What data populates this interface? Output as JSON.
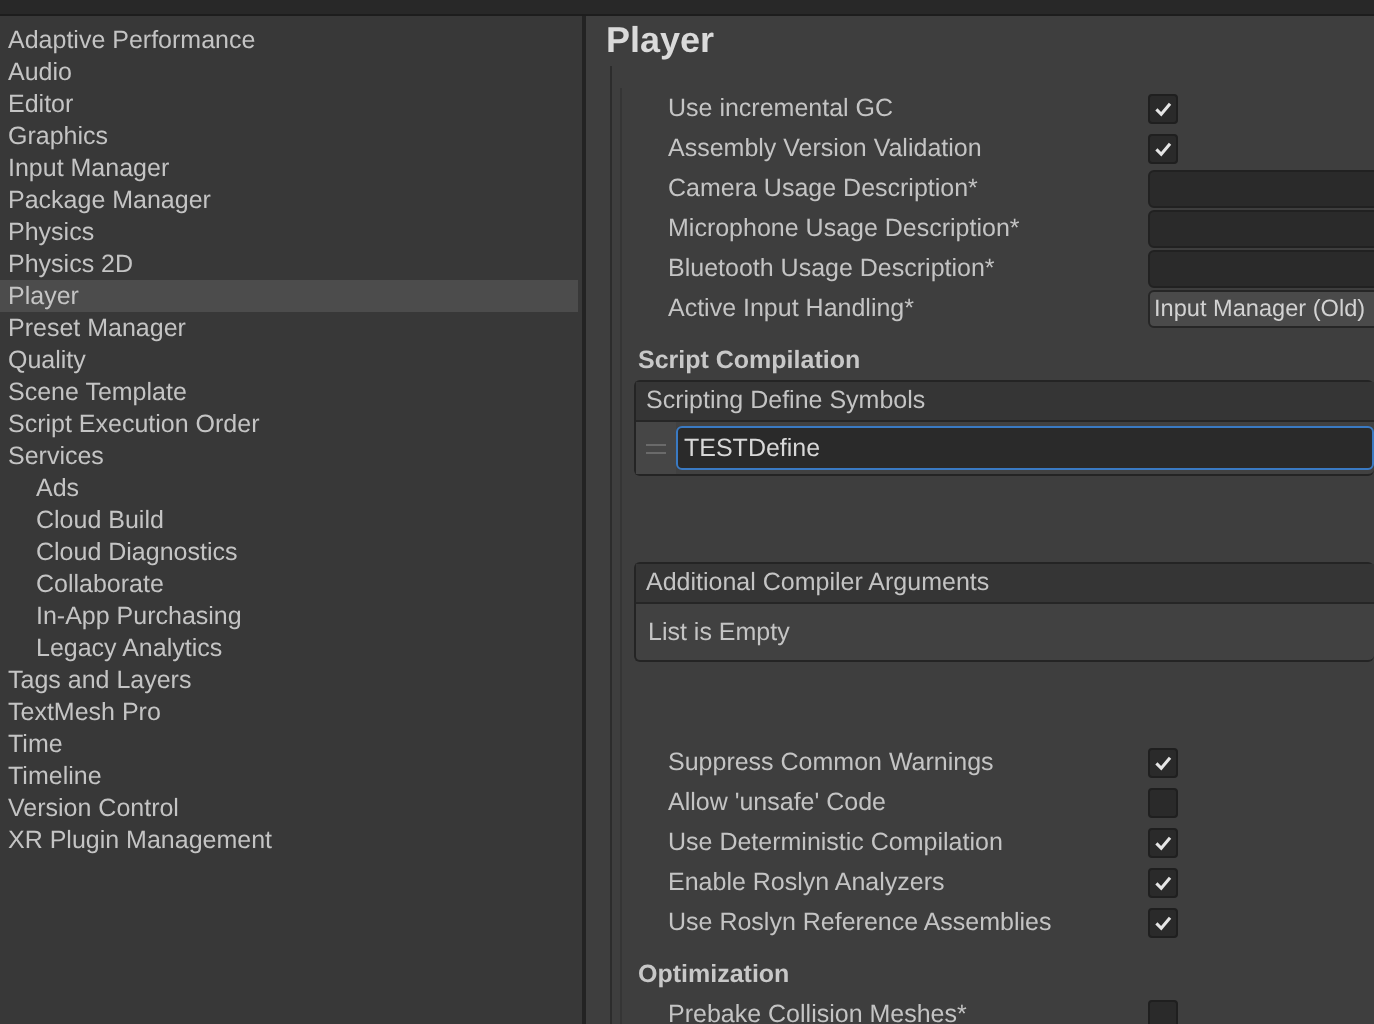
{
  "sidebar": {
    "items": [
      {
        "label": "Adaptive Performance",
        "selected": false
      },
      {
        "label": "Audio",
        "selected": false
      },
      {
        "label": "Editor",
        "selected": false
      },
      {
        "label": "Graphics",
        "selected": false
      },
      {
        "label": "Input Manager",
        "selected": false
      },
      {
        "label": "Package Manager",
        "selected": false
      },
      {
        "label": "Physics",
        "selected": false
      },
      {
        "label": "Physics 2D",
        "selected": false
      },
      {
        "label": "Player",
        "selected": true
      },
      {
        "label": "Preset Manager",
        "selected": false
      },
      {
        "label": "Quality",
        "selected": false
      },
      {
        "label": "Scene Template",
        "selected": false
      },
      {
        "label": "Script Execution Order",
        "selected": false
      },
      {
        "label": "Services",
        "selected": false,
        "children": [
          {
            "label": "Ads",
            "selected": false
          },
          {
            "label": "Cloud Build",
            "selected": false
          },
          {
            "label": "Cloud Diagnostics",
            "selected": false
          },
          {
            "label": "Collaborate",
            "selected": false
          },
          {
            "label": "In-App Purchasing",
            "selected": false
          },
          {
            "label": "Legacy Analytics",
            "selected": false
          }
        ]
      },
      {
        "label": "Tags and Layers",
        "selected": false
      },
      {
        "label": "TextMesh Pro",
        "selected": false
      },
      {
        "label": "Time",
        "selected": false
      },
      {
        "label": "Timeline",
        "selected": false
      },
      {
        "label": "Version Control",
        "selected": false
      },
      {
        "label": "XR Plugin Management",
        "selected": false
      }
    ]
  },
  "panel": {
    "title": "Player",
    "sections": [
      {
        "kind": "rows",
        "rows": [
          {
            "kind": "checkbox",
            "label": "Use incremental GC",
            "checked": true
          },
          {
            "kind": "checkbox",
            "label": "Assembly Version Validation",
            "checked": true
          },
          {
            "kind": "text_field",
            "label": "Camera Usage Description*"
          },
          {
            "kind": "text_field",
            "label": "Microphone Usage Description*"
          },
          {
            "kind": "text_field",
            "label": "Bluetooth Usage Description*"
          },
          {
            "kind": "dropdown",
            "label": "Active Input Handling*",
            "value": "Input Manager (Old)",
            "disabled": false
          }
        ]
      },
      {
        "kind": "heading",
        "title": "Script Compilation"
      },
      {
        "kind": "list",
        "title": "Scripting Define Symbols",
        "items": [
          {
            "value": "TESTDefine",
            "focused": true
          }
        ]
      },
      {
        "kind": "list",
        "title": "Additional Compiler Arguments",
        "empty_text": "List is Empty"
      },
      {
        "kind": "rows",
        "rows": [
          {
            "kind": "checkbox",
            "label": "Suppress Common Warnings",
            "checked": true
          },
          {
            "kind": "checkbox",
            "label": "Allow 'unsafe' Code",
            "checked": false
          },
          {
            "kind": "checkbox",
            "label": "Use Deterministic Compilation",
            "checked": true
          },
          {
            "kind": "checkbox",
            "label": "Enable Roslyn Analyzers",
            "checked": true
          },
          {
            "kind": "checkbox",
            "label": "Use Roslyn Reference Assemblies",
            "checked": true
          }
        ]
      },
      {
        "kind": "heading",
        "title": "Optimization"
      },
      {
        "kind": "rows",
        "rows": [
          {
            "kind": "checkbox",
            "label": "Prebake Collision Meshes*",
            "checked": false
          }
        ]
      }
    ]
  }
}
